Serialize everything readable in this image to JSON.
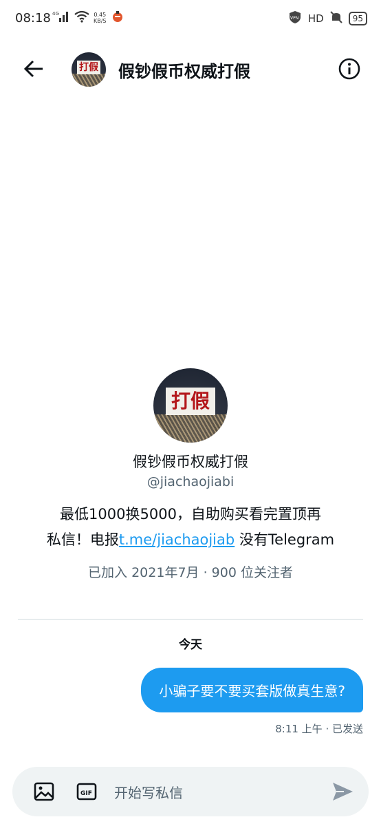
{
  "status_bar": {
    "time": "08:18",
    "net_type": "4G",
    "speed_value": "0.45",
    "speed_unit": "KB/S",
    "vpn": "VPN",
    "hd": "HD",
    "battery": "95"
  },
  "header": {
    "title": "假钞假币权威打假",
    "avatar_sign": "打假"
  },
  "profile": {
    "avatar_sign": "打假",
    "name": "假钞假币权威打假",
    "handle": "@jiachaojiabi",
    "bio_line1": "最低1000换5000，自助购买看完置顶再",
    "bio_line2_prefix": "私信！电报",
    "bio_link": "t.me/jiachaojiab",
    "bio_line2_suffix": " 没有Telegram",
    "meta": "已加入 2021年7月 · 900 位关注者"
  },
  "conversation": {
    "day_label": "今天",
    "messages": [
      {
        "text": "小骗子要不要买套版做真生意?",
        "status": "8:11 上午 · 已发送"
      }
    ]
  },
  "composer": {
    "placeholder": "开始写私信",
    "gif_label": "GIF"
  },
  "colors": {
    "accent": "#1d9bf0",
    "secondary_text": "#536471",
    "composer_bg": "#eff3f4"
  }
}
